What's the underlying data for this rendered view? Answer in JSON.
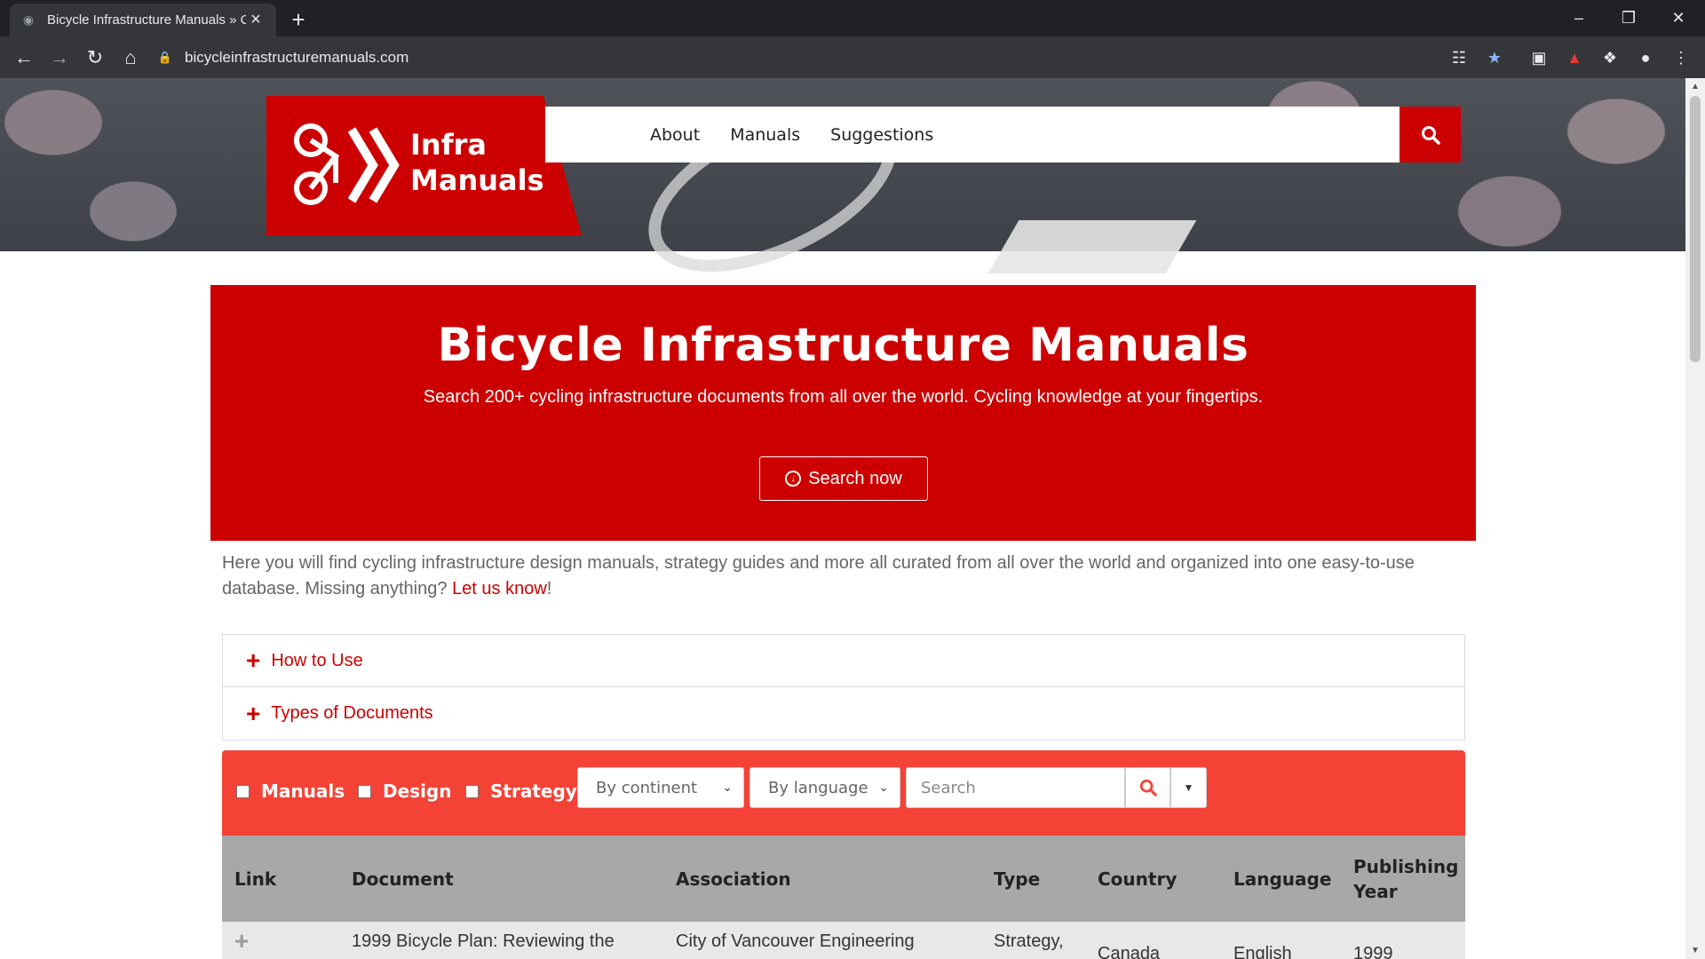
{
  "browser": {
    "tab_title": "Bicycle Infrastructure Manuals » C",
    "url": "bicycleinfrastructuremanuals.com"
  },
  "site": {
    "logo_line1": "Infra",
    "logo_line2": "Manuals",
    "nav": [
      "About",
      "Manuals",
      "Suggestions"
    ]
  },
  "banner": {
    "title": "Bicycle Infrastructure Manuals",
    "subtitle": "Search 200+ cycling infrastructure documents from all over the world. Cycling knowledge at your fingertips.",
    "cta": "Search now"
  },
  "intro": {
    "text": "Here you will find cycling infrastructure design manuals, strategy guides and more all curated from all over the world and organized into one easy-to-use database. Missing anything? ",
    "link": "Let us know",
    "tail": "!"
  },
  "accordion": [
    "How to Use",
    "Types of Documents"
  ],
  "filters": {
    "checkboxes": [
      "Manuals",
      "Design",
      "Strategy"
    ],
    "continent": "By continent",
    "language": "By language",
    "search_placeholder": "Search"
  },
  "table": {
    "headers": [
      "Link",
      "Document",
      "Association",
      "Type",
      "Country",
      "Language",
      "Publishing Year"
    ],
    "row1": {
      "document": "1999 Bicycle Plan: Reviewing the",
      "association": "City of Vancouver Engineering",
      "type": "Strategy,",
      "country": "Canada",
      "language": "English",
      "year": "1999"
    }
  },
  "colors": {
    "brand_red": "#cc0000",
    "filter_red": "#f44336",
    "table_header": "#a8a8a8"
  }
}
